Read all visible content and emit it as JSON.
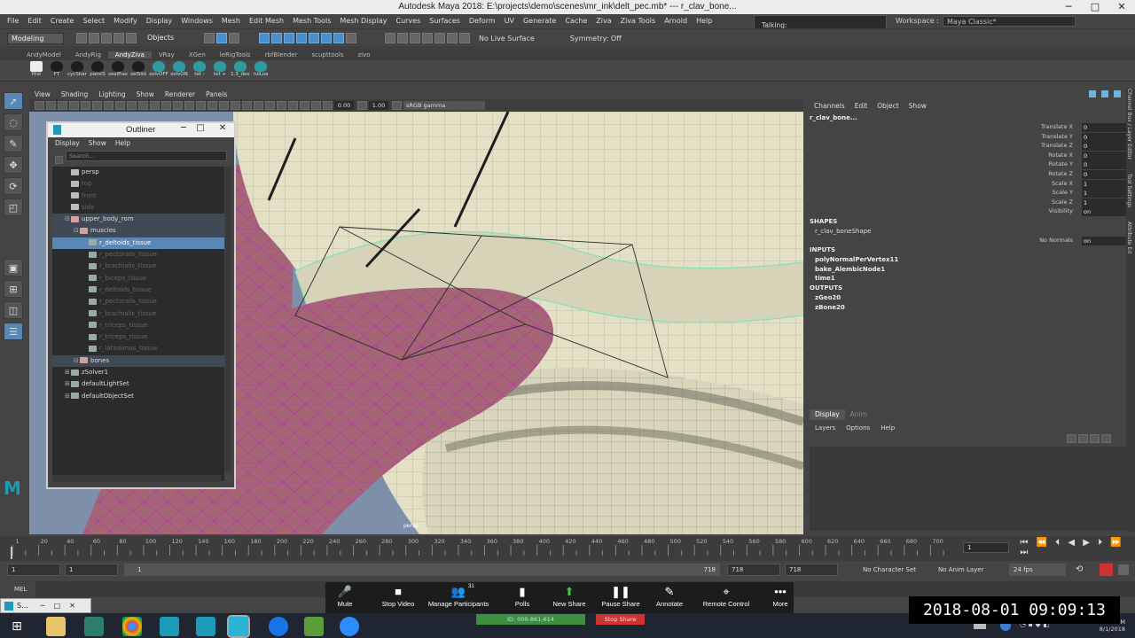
{
  "window": {
    "title": "Autodesk Maya 2018: E:\\projects\\demo\\scenes\\mr_ink\\delt_pec.mb*  ---  r_clav_bone...",
    "minimize": "─",
    "maximize": "□",
    "close": "✕"
  },
  "menubar": [
    "File",
    "Edit",
    "Create",
    "Select",
    "Modify",
    "Display",
    "Windows",
    "Mesh",
    "Edit Mesh",
    "Mesh Tools",
    "Mesh Display",
    "Curves",
    "Surfaces",
    "Deform",
    "UV",
    "Generate",
    "Cache",
    "Ziva",
    "Ziva Tools",
    "Arnold",
    "Help"
  ],
  "workspace": {
    "label": "Workspace :",
    "value": "Maya Classic*"
  },
  "statusline": {
    "mode": "Modeling",
    "objects": "Objects",
    "live_surface": "No Live Surface",
    "symmetry": "Symmetry: Off"
  },
  "talking": "Talking:",
  "shelf": {
    "tabs": [
      "AndyModel",
      "AndyRig",
      "AndyZiva",
      "VRay",
      "XGen",
      "leRigTools",
      "rbfBlender",
      "scupttools",
      "zivo"
    ],
    "active_tab": "AndyZiva",
    "items": [
      "Hist",
      "FT",
      "cycShar",
      "paintS",
      "sealFiax",
      "selSlid",
      "solvOFF",
      "solvON",
      "tet -",
      "tet +",
      "1.3_dev",
      "rulLoa"
    ]
  },
  "viewport": {
    "menu": [
      "View",
      "Shading",
      "Lighting",
      "Show",
      "Renderer",
      "Panels"
    ],
    "value_a": "0.00",
    "value_b": "1.00",
    "colorspace": "sRGB gamma",
    "camera_label": "persp"
  },
  "outliner": {
    "title": "Outliner",
    "menu": [
      "Display",
      "Show",
      "Help"
    ],
    "search_placeholder": "Search...",
    "items": [
      {
        "label": "persp",
        "state": "normal",
        "indent": 1
      },
      {
        "label": "top",
        "state": "dim",
        "indent": 1
      },
      {
        "label": "front",
        "state": "dim",
        "indent": 1
      },
      {
        "label": "side",
        "state": "dim",
        "indent": 1
      },
      {
        "label": "upper_body_rom",
        "state": "group",
        "indent": 1
      },
      {
        "label": "muscles",
        "state": "group",
        "indent": 2
      },
      {
        "label": "r_deltoids_tissue",
        "state": "selected",
        "indent": 3
      },
      {
        "label": "r_pectoralis_tissue",
        "state": "dim",
        "indent": 3
      },
      {
        "label": "r_brachialis_tissue",
        "state": "dim",
        "indent": 3
      },
      {
        "label": "r_biceps_tissue",
        "state": "dim",
        "indent": 3
      },
      {
        "label": "r_deltoids_tissue",
        "state": "dim",
        "indent": 3
      },
      {
        "label": "r_pectoralis_tissue",
        "state": "dim",
        "indent": 3
      },
      {
        "label": "r_brachialis_tissue",
        "state": "dim",
        "indent": 3
      },
      {
        "label": "r_triceps_tissue",
        "state": "dim",
        "indent": 3
      },
      {
        "label": "r_triceps_tissue",
        "state": "dim",
        "indent": 3
      },
      {
        "label": "r_latissimus_tissue",
        "state": "dim",
        "indent": 3
      },
      {
        "label": "bones",
        "state": "group",
        "indent": 2
      },
      {
        "label": "zSolver1",
        "state": "normal",
        "indent": 1
      },
      {
        "label": "defaultLightSet",
        "state": "normal",
        "indent": 1
      },
      {
        "label": "defaultObjectSet",
        "state": "normal",
        "indent": 1
      }
    ]
  },
  "channelbox": {
    "menu": [
      "Channels",
      "Edit",
      "Object",
      "Show"
    ],
    "object": "r_clav_bone...",
    "attributes": [
      {
        "name": "Translate X",
        "value": "0"
      },
      {
        "name": "Translate Y",
        "value": "0"
      },
      {
        "name": "Translate Z",
        "value": "0"
      },
      {
        "name": "Rotate X",
        "value": "0"
      },
      {
        "name": "Rotate Y",
        "value": "0"
      },
      {
        "name": "Rotate Z",
        "value": "0"
      },
      {
        "name": "Scale X",
        "value": "1"
      },
      {
        "name": "Scale Y",
        "value": "1"
      },
      {
        "name": "Scale Z",
        "value": "1"
      },
      {
        "name": "Visibility",
        "value": "on"
      }
    ],
    "shapes_header": "SHAPES",
    "shape": "r_clav_boneShape",
    "no_normals": {
      "name": "No Normals",
      "value": "on"
    },
    "inputs_header": "INPUTS",
    "inputs": [
      "polyNormalPerVertex11",
      "bake_AlembicNode1",
      "time1"
    ],
    "outputs_header": "OUTPUTS",
    "outputs": [
      "zGeo20",
      "zBone20"
    ]
  },
  "layer_editor": {
    "tabs": [
      "Display",
      "Anim"
    ],
    "active": "Display",
    "menu": [
      "Layers",
      "Options",
      "Help"
    ]
  },
  "side_tabs": [
    "Channel Box / Layer Editor",
    "Tool Settings",
    "Attribute Ed"
  ],
  "timeslider": {
    "ticks": [
      "1",
      "20",
      "40",
      "60",
      "80",
      "100",
      "120",
      "140",
      "160",
      "180",
      "200",
      "220",
      "240",
      "260",
      "280",
      "300",
      "320",
      "340",
      "360",
      "380",
      "400",
      "420",
      "440",
      "460",
      "480",
      "500",
      "520",
      "540",
      "560",
      "580",
      "600",
      "620",
      "640",
      "660",
      "680",
      "700"
    ],
    "current_frame": "1"
  },
  "range": {
    "start": "1",
    "start2": "1",
    "range_inner_start": "1",
    "range_inner_end": "718",
    "end": "718",
    "end2": "718",
    "char_set": "No Character Set",
    "anim_layer": "No Anim Layer",
    "fps": "24 fps"
  },
  "cmdline": {
    "label": "MEL"
  },
  "zoom": {
    "buttons": [
      {
        "label": "Mute",
        "icon": "🎤"
      },
      {
        "label": "Stop Video",
        "icon": "■"
      },
      {
        "label": "Manage Participants",
        "icon": "👥",
        "badge": "31"
      },
      {
        "label": "Polls",
        "icon": "▮"
      },
      {
        "label": "New Share",
        "icon": "⬆"
      },
      {
        "label": "Pause Share",
        "icon": "❚❚"
      },
      {
        "label": "Annotate",
        "icon": "✎"
      },
      {
        "label": "Remote Control",
        "icon": "⌖"
      },
      {
        "label": "More",
        "icon": "•••"
      }
    ],
    "share_info": "ID: 000-861-614",
    "stop_share": "Stop Share"
  },
  "miniwin": {
    "title": "S..."
  },
  "clock": "2018-08-01  09:09:13",
  "taskbar_date": {
    "time": "9:09 AM",
    "date": "8/1/2018"
  },
  "colors": {
    "accent": "#5b87b5",
    "maya_teal": "#1b9bb8",
    "zoom_green": "#3c8f3c"
  }
}
